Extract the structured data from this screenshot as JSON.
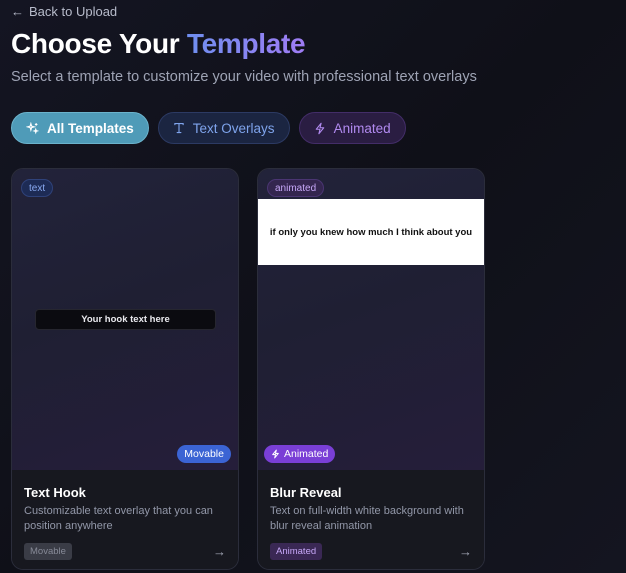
{
  "nav": {
    "back_label": "Back to Upload",
    "back_icon": "arrow-left-icon"
  },
  "header": {
    "title_prefix": "Choose Your",
    "title_accent": "Template",
    "subtitle": "Select a template to customize your video with professional text overlays"
  },
  "filters": [
    {
      "label": "All Templates",
      "icon": "sparkles-icon",
      "active": true
    },
    {
      "label": "Text Overlays",
      "icon": "type-icon",
      "active": false
    },
    {
      "label": "Animated",
      "icon": "zap-icon",
      "active": false
    }
  ],
  "templates": [
    {
      "type_badge": "text",
      "preview_text": "Your hook text here",
      "corner_badge": "Movable",
      "title": "Text Hook",
      "description": "Customizable text overlay that you can position anywhere",
      "tag": "Movable"
    },
    {
      "type_badge": "animated",
      "preview_text": "if only you knew how much I think about you",
      "corner_badge": "Animated",
      "title": "Blur Reveal",
      "description": "Text on full-width white background with blur reveal animation",
      "tag": "Animated"
    }
  ],
  "colors": {
    "accent_blue": "#6f8ff0",
    "accent_purple": "#9f7cf4",
    "active_filter": "#4f9bb8",
    "movable_badge": "#3b64d4",
    "animated_badge": "#7a3fd6"
  }
}
